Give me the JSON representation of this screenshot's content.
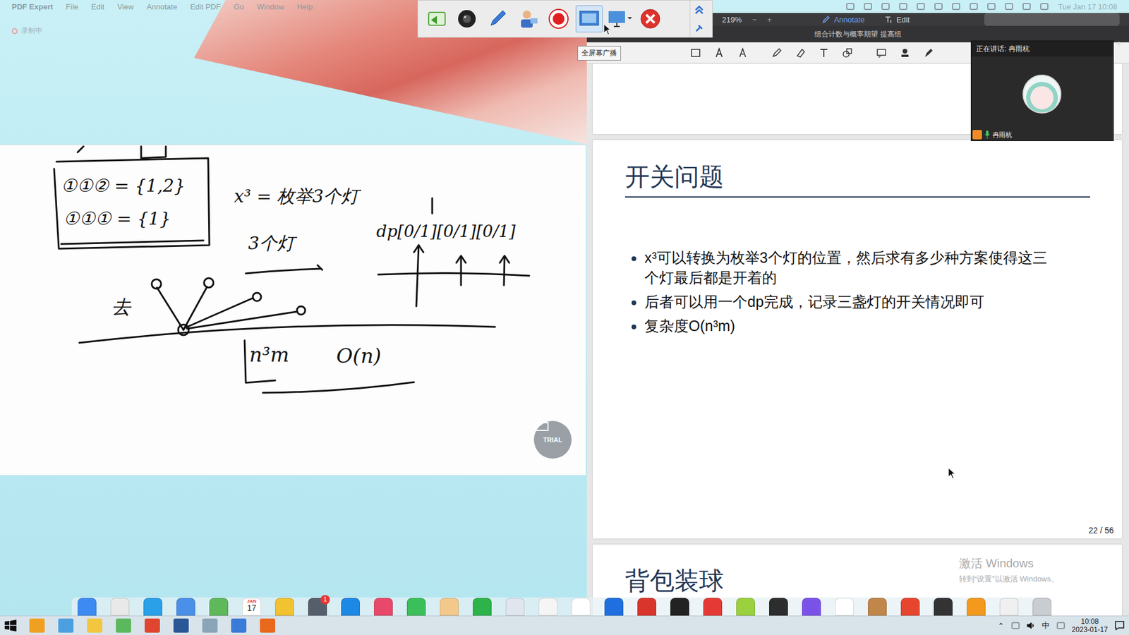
{
  "menubar": {
    "app": "PDF Expert",
    "items": [
      "File",
      "Edit",
      "View",
      "Annotate",
      "Edit PDF",
      "Go",
      "Window",
      "Help"
    ],
    "clock": "Tue Jan 17  10:08"
  },
  "recording": {
    "label": "录制中"
  },
  "toolbar": {
    "buttons": [
      {
        "selected": false
      },
      {
        "selected": false
      },
      {
        "selected": false
      },
      {
        "selected": false
      },
      {
        "selected": false
      },
      {
        "selected": true
      },
      {
        "selected": false
      },
      {
        "selected": false
      }
    ],
    "tooltip": "全屏幕广播"
  },
  "whiteboard": {
    "texts": [
      "①①② = {1,2}",
      "①①① = {1}",
      "x³ = 枚举3个灯",
      "3个灯",
      "dp[0/1][0/1][0/1]",
      "去",
      "n³m",
      "O(n)"
    ],
    "badge": "TRIAL"
  },
  "pdf": {
    "zoom": "219%",
    "mode_tabs": [
      {
        "label": "Annotate",
        "selected": true
      },
      {
        "label": "Edit",
        "selected": false
      }
    ],
    "title": "组合计数与概率期望 提高组",
    "page": {
      "title": "开关问题",
      "bullets": [
        "x³可以转换为枚举3个灯的位置，然后求有多少种方案使得这三个灯最后都是开着的",
        "后者可以用一个dp完成，记录三盏灯的开关情况即可",
        "复杂度O(n³m)"
      ],
      "number": "22 / 56"
    },
    "next_page_title": "背包装球"
  },
  "video": {
    "speaking": "正在讲话: 冉雨杭",
    "name": "冉雨杭",
    "new_tab": "+"
  },
  "watermark": {
    "title": "激活 Windows",
    "subtitle": "转到“设置”以激活 Windows。"
  },
  "dock": {
    "calendar": {
      "month": "JAN",
      "day": "17"
    },
    "badge": "1"
  },
  "taskbar": {
    "ime": "中",
    "time": "10:08",
    "date": "2023-01-17"
  }
}
